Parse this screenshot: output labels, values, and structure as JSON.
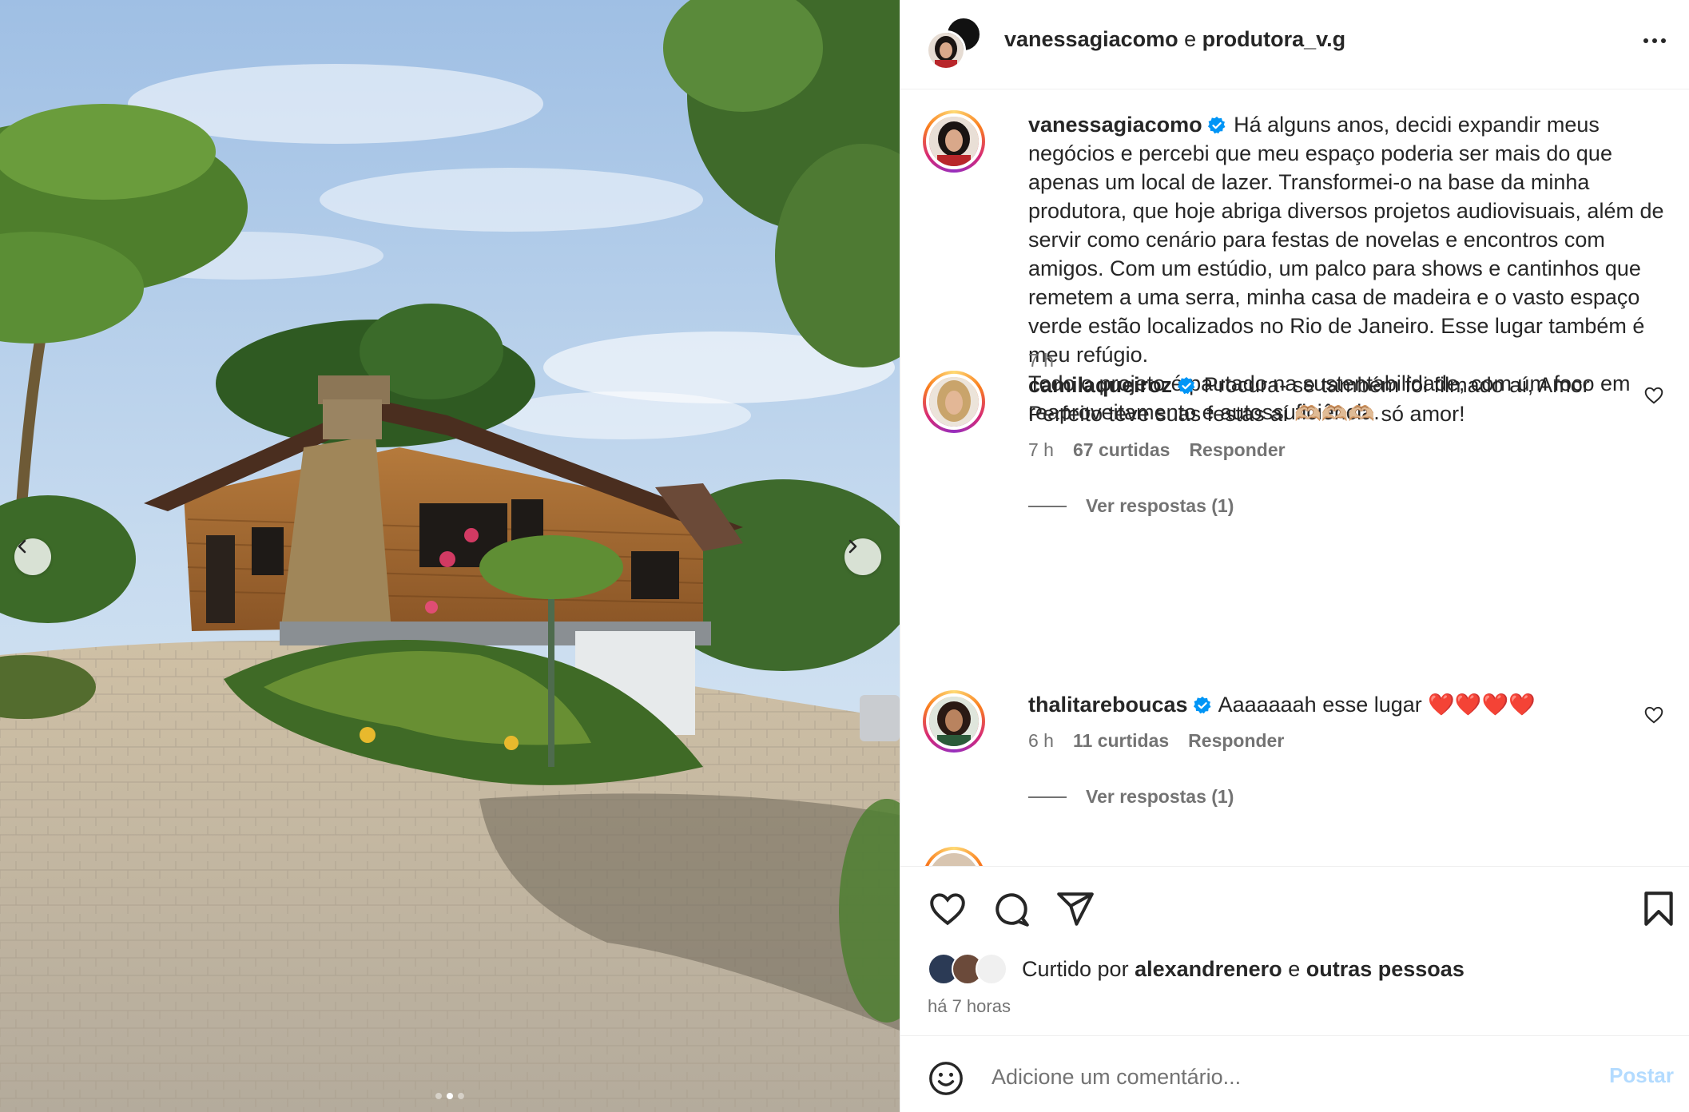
{
  "header": {
    "user1": "vanessagiacomo",
    "conjunction": "e",
    "user2": "produtora_v.g",
    "more_icon": "more-horizontal-icon"
  },
  "caption": {
    "username": "vanessagiacomo",
    "text": "Há alguns anos, decidi expandir meus negócios e percebi que meu espaço poderia ser mais do que apenas um local de lazer. Transformei-o na base da minha produtora, que hoje abriga diversos projetos audiovisuais, além de servir como cenário para festas de novelas e encontros com amigos. Com um estúdio, um palco para shows e cantinhos que remetem a uma serra, minha casa de madeira e o vasto espaço verde estão localizados no Rio de Janeiro. Esse lugar também é meu refúgio.",
    "text2": "Todo o projeto é pautado na sustentabilidade, com um foco em reaproveitamento e autossuficiência.",
    "time": "7 h"
  },
  "comments": [
    {
      "username": "camilaqueiroz",
      "text": "Procura- se também foi filmado aí, Amor Perfeito teve suas festas aí 🫶🏼🫶🏼🫶🏼 só amor!",
      "time": "7 h",
      "likes": "67 curtidas",
      "reply": "Responder",
      "view_replies": "Ver respostas (1)"
    },
    {
      "username": "thalitareboucas",
      "text": "Aaaaaaah esse lugar ❤️❤️❤️❤️",
      "time": "6 h",
      "likes": "11 curtidas",
      "reply": "Responder",
      "view_replies": "Ver respostas (1)"
    }
  ],
  "actions": {
    "liked_by_prefix": "Curtido por",
    "liked_by_user": "alexandrenero",
    "liked_by_and": "e",
    "liked_by_others": "outras pessoas",
    "time_ago": "há 7 horas"
  },
  "add_comment": {
    "placeholder": "Adicione um comentário...",
    "post_label": "Postar"
  },
  "colors": {
    "verified": "#0095f6",
    "post_disabled": "#b3dbff",
    "secondary_text": "#737373"
  }
}
